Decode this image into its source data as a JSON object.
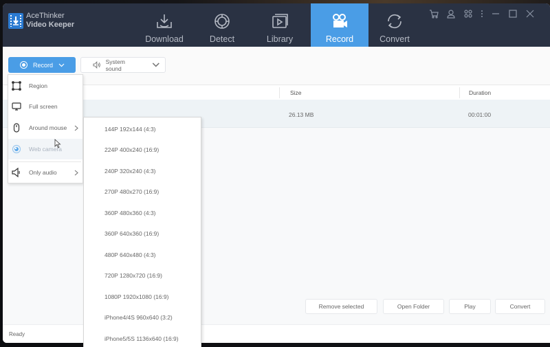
{
  "app": {
    "name_line1": "AceThinker",
    "name_line2": "Video Keeper"
  },
  "nav": {
    "tabs": [
      {
        "label": "Download",
        "icon": "download-icon",
        "active": false
      },
      {
        "label": "Detect",
        "icon": "detect-icon",
        "active": false
      },
      {
        "label": "Library",
        "icon": "library-icon",
        "active": false
      },
      {
        "label": "Record",
        "icon": "video-camera-icon",
        "active": true
      },
      {
        "label": "Convert",
        "icon": "convert-icon",
        "active": false
      }
    ],
    "active_color": "#4a9de6"
  },
  "window_controls": [
    "cart-icon",
    "user-icon",
    "apps-icon",
    "more-icon",
    "minimize-icon",
    "maximize-icon",
    "close-icon"
  ],
  "toolbar": {
    "record_label": "Record",
    "system_sound_label": "System sound"
  },
  "record_menu": {
    "items": [
      {
        "label": "Region",
        "icon": "region-icon",
        "submenu": false
      },
      {
        "label": "Full screen",
        "icon": "monitor-icon",
        "submenu": false
      },
      {
        "label": "Around mouse",
        "icon": "mouse-icon",
        "submenu": true
      },
      {
        "label": "Web camera",
        "icon": "webcam-icon",
        "submenu": false,
        "hovered": true
      },
      {
        "label": "Only audio",
        "icon": "speaker-icon",
        "submenu": true
      }
    ]
  },
  "resolution_menu": {
    "items": [
      "144P 192x144 (4:3)",
      "224P 400x240 (16:9)",
      "240P 320x240 (4:3)",
      "270P 480x270 (16:9)",
      "360P 480x360 (4:3)",
      "360P 640x360 (16:9)",
      "480P 640x480 (4:3)",
      "720P 1280x720 (16:9)",
      "1080P 1920x1080 (16:9)",
      "iPhone4/4S 960x640 (3:2)",
      "iPhone5/5S 1136x640 (16:9)"
    ]
  },
  "table": {
    "columns": [
      "Size",
      "Duration"
    ],
    "rows": [
      {
        "size": "26.13 MB",
        "duration": "00:01:00"
      }
    ]
  },
  "actions": {
    "remove_selected": "Remove selected",
    "open_folder": "Open Folder",
    "play": "Play",
    "convert": "Convert"
  },
  "status": {
    "text": "Ready"
  }
}
